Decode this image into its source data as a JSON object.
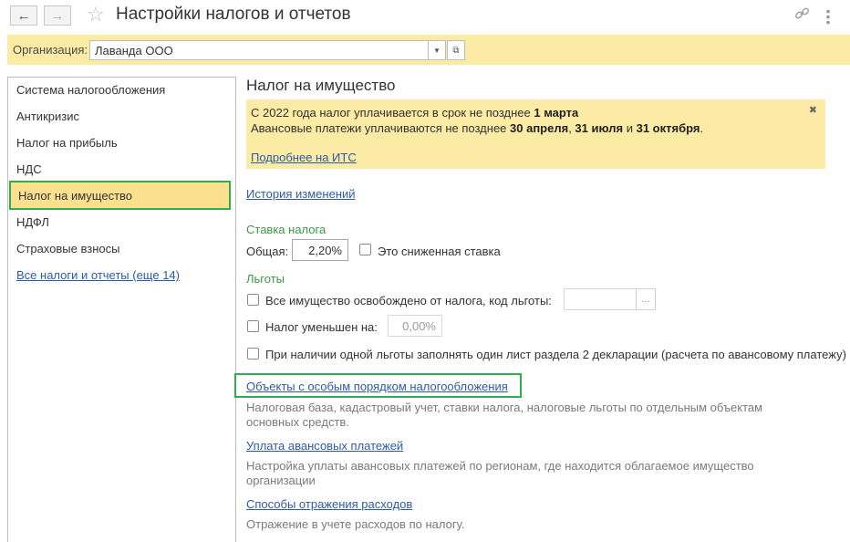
{
  "header": {
    "title": "Настройки налогов и отчетов"
  },
  "org": {
    "label": "Организация:",
    "value": "Лаванда ООО"
  },
  "sidebar": {
    "items": [
      {
        "label": "Система налогообложения"
      },
      {
        "label": "Антикризис"
      },
      {
        "label": "Налог на прибыль"
      },
      {
        "label": "НДС"
      },
      {
        "label": "Налог на имущество",
        "active": true
      },
      {
        "label": "НДФЛ"
      },
      {
        "label": "Страховые взносы"
      }
    ],
    "all_link": "Все налоги и отчеты (еще 14)"
  },
  "main": {
    "heading": "Налог на имущество",
    "notice": {
      "line1_pre": "С 2022 года налог уплачивается в срок не позднее ",
      "line1_bold": "1 марта",
      "line2_pre": "Авансовые платежи уплачиваются не позднее ",
      "line2_b1": "30 апреля",
      "line2_sep": ", ",
      "line2_b2": "31 июля",
      "line2_and": " и ",
      "line2_b3": "31 октября",
      "line2_end": ".",
      "link": "Подробнее на ИТС"
    },
    "history_link": "История изменений",
    "rate": {
      "section": "Ставка налога",
      "label": "Общая:",
      "value": "2,20%",
      "reduced_label": "Это сниженная ставка"
    },
    "benefits": {
      "section": "Льготы",
      "exempt_label": "Все имущество освобождено от налога, код льготы:",
      "exempt_code": "",
      "reduced_label": "Налог уменьшен на:",
      "reduced_value": "0,00%",
      "single_sheet_label": "При наличии одной льготы заполнять один лист раздела 2 декларации (расчета по авансовому платежу)"
    },
    "objects": {
      "link": "Объекты с особым порядком налогообложения",
      "desc1": "Налоговая база, кадастровый учет, ставки налога, налоговые льготы по отдельным объектам",
      "desc2": "основных средств."
    },
    "advance": {
      "link": "Уплата авансовых платежей",
      "desc1": "Настройка уплаты авансовых платежей по регионам, где находится облагаемое имущество",
      "desc2": "организации"
    },
    "expenses": {
      "link": "Способы отражения расходов",
      "desc1": "Отражение в учете расходов по налогу."
    }
  }
}
